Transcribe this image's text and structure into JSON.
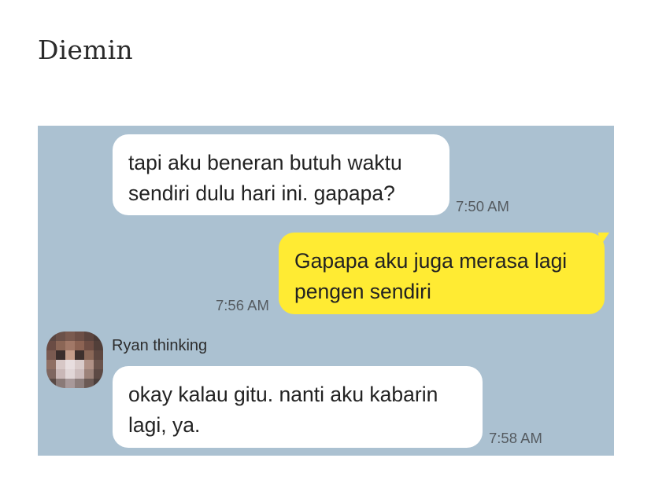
{
  "page": {
    "title": "Diemin"
  },
  "chat": {
    "messages": [
      {
        "direction": "incoming",
        "lines": [
          "tapi aku beneran butuh waktu",
          "sendiri dulu hari ini. gapapa?"
        ],
        "time": "7:50 AM"
      },
      {
        "direction": "outgoing",
        "lines": [
          "Gapapa aku juga merasa lagi",
          "pengen sendiri"
        ],
        "time": "7:56 AM"
      },
      {
        "direction": "incoming",
        "sender": "Ryan thinking",
        "lines": [
          "okay kalau gitu. nanti aku kabarin",
          "lagi, ya."
        ],
        "time": "7:58 AM"
      }
    ],
    "colors": {
      "background": "#abc1d1",
      "incoming_bubble": "#ffffff",
      "outgoing_bubble": "#ffeb33"
    },
    "avatar_icon": "pixelated-avatar-icon"
  }
}
